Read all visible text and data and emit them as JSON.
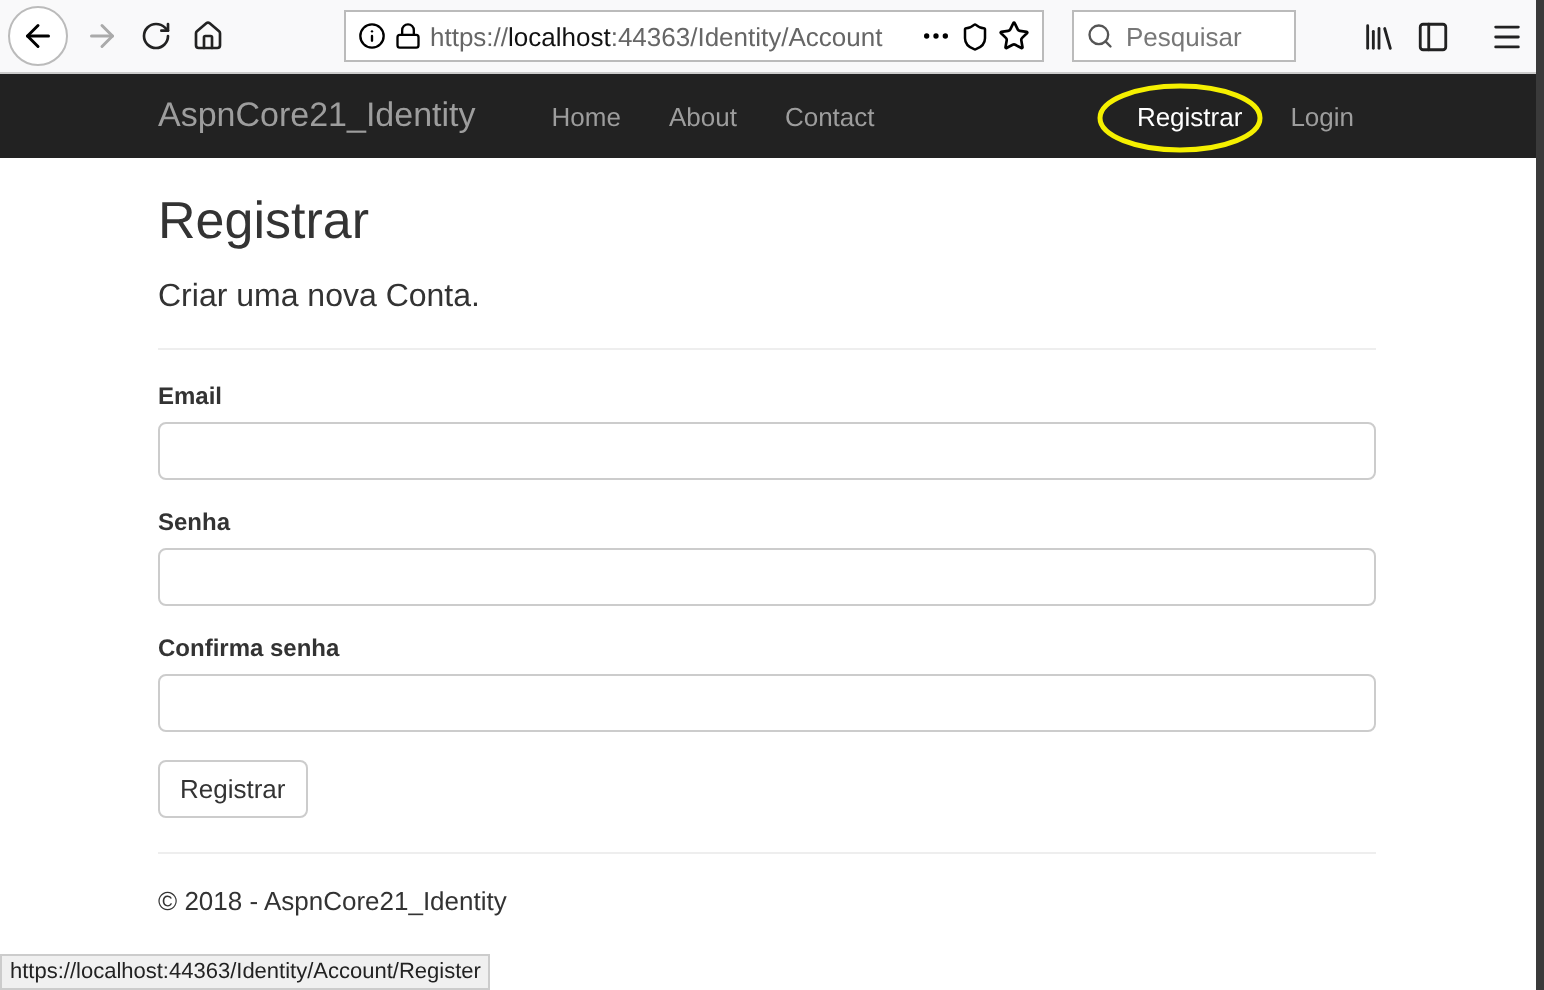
{
  "browser": {
    "url_scheme": "https://",
    "url_host": "localhost",
    "url_path": ":44363/Identity/Account",
    "search_placeholder": "Pesquisar"
  },
  "navbar": {
    "brand": "AspnCore21_Identity",
    "links": [
      {
        "label": "Home",
        "selected": false
      },
      {
        "label": "About",
        "selected": false
      },
      {
        "label": "Contact",
        "selected": false
      }
    ],
    "right_links": [
      {
        "label": "Registrar",
        "selected": true,
        "highlighted": true
      },
      {
        "label": "Login",
        "selected": false,
        "highlighted": false
      }
    ]
  },
  "page": {
    "title": "Registrar",
    "subtitle": "Criar uma nova Conta.",
    "fields": [
      {
        "label": "Email"
      },
      {
        "label": "Senha"
      },
      {
        "label": "Confirma senha"
      }
    ],
    "submit": "Registrar"
  },
  "footer": "© 2018 - AspnCore21_Identity",
  "status_bar": "https://localhost:44363/Identity/Account/Register"
}
